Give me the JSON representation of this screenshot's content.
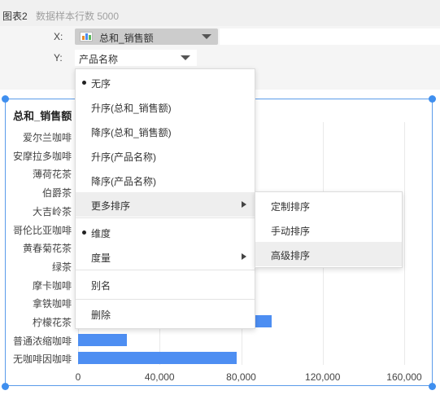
{
  "header": {
    "chart_name": "图表2",
    "row_count_text": "数据样本行数 5000"
  },
  "config": {
    "x_label": "X:",
    "x_value": "总和_销售额",
    "y_label": "Y:",
    "y_value": "产品名称"
  },
  "chart_data": {
    "type": "bar",
    "orientation": "horizontal",
    "title": "总和_销售额",
    "categories": [
      "爱尔兰咖啡",
      "安摩拉多咖啡",
      "薄荷花茶",
      "伯爵茶",
      "大吉岭茶",
      "哥伦比亚咖啡",
      "黄春菊花茶",
      "绿茶",
      "摩卡咖啡",
      "拿铁咖啡",
      "柠檬花茶",
      "普通浓缩咖啡",
      "无咖啡因咖啡"
    ],
    "visible_values": {
      "10": 95000,
      "11": 24000,
      "12": 78000
    },
    "xlim": [
      0,
      170000
    ],
    "xticks": [
      0,
      40000,
      80000,
      120000,
      160000
    ],
    "xtick_labels": [
      "0",
      "40,000",
      "80,000",
      "120,000",
      "160,000"
    ],
    "bar_color": "#4d8ef2",
    "grid": true
  },
  "menu": {
    "items": [
      {
        "label": "无序",
        "selected": true
      },
      {
        "label": "升序(总和_销售额)"
      },
      {
        "label": "降序(总和_销售额)"
      },
      {
        "label": "升序(产品名称)"
      },
      {
        "label": "降序(产品名称)"
      },
      {
        "label": "更多排序",
        "has_submenu": true,
        "hover": true
      },
      {
        "label": "维度",
        "selected": true
      },
      {
        "label": "度量",
        "has_submenu": true
      },
      {
        "label": "别名"
      },
      {
        "label": "删除"
      }
    ],
    "submenu": [
      {
        "label": "定制排序"
      },
      {
        "label": "手动排序"
      },
      {
        "label": "高级排序",
        "hover": true
      }
    ]
  }
}
